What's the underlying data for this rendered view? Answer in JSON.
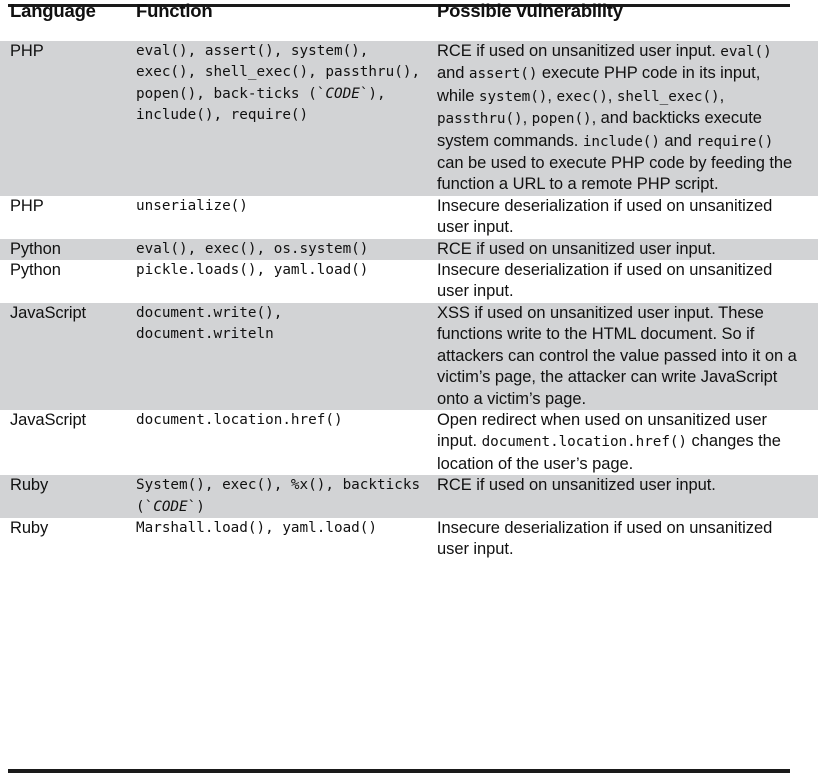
{
  "table": {
    "columns": [
      {
        "key": "language",
        "label": "Language"
      },
      {
        "key": "function",
        "label": "Function"
      },
      {
        "key": "vulnerability",
        "label": "Possible vulnerability"
      }
    ],
    "colors": {
      "shaded_row": "#d2d3d5",
      "plain_row": "#ffffff",
      "rule": "#1a1a1a",
      "text": "#111111"
    },
    "rows": [
      {
        "shaded": true,
        "language": "PHP",
        "function_plain": "eval(), assert(), system(), exec(), shell_exec(), passthru(), popen(), backticks (`CODE`), include(), require()",
        "function_parts": [
          {
            "type": "code",
            "text": "eval(), assert(), system(), exec(), shell_exec(), passthru(), popen(), back-ticks (`"
          },
          {
            "type": "code-italic",
            "text": "CODE"
          },
          {
            "type": "code",
            "text": "`), include(), require()"
          }
        ],
        "vulnerability_plain": "RCE if used on unsanitized user input. eval() and assert() execute PHP code in its input, while system(), exec(), shell_exec(), passthru(), popen(), and backticks execute system commands. include() and require() can be used to execute PHP code by feeding the function a URL to a remote PHP script.",
        "vulnerability_parts": [
          {
            "type": "text",
            "text": "RCE if used on unsanitized user input. "
          },
          {
            "type": "code",
            "text": "eval()"
          },
          {
            "type": "text",
            "text": " and "
          },
          {
            "type": "code",
            "text": "assert()"
          },
          {
            "type": "text",
            "text": " execute PHP code in its input, while "
          },
          {
            "type": "code",
            "text": "system()"
          },
          {
            "type": "text",
            "text": ", "
          },
          {
            "type": "code",
            "text": "exec()"
          },
          {
            "type": "text",
            "text": ", "
          },
          {
            "type": "code",
            "text": "shell_exec()"
          },
          {
            "type": "text",
            "text": ", "
          },
          {
            "type": "code",
            "text": "passthru()"
          },
          {
            "type": "text",
            "text": ", "
          },
          {
            "type": "code",
            "text": "popen()"
          },
          {
            "type": "text",
            "text": ", and backticks execute system commands. "
          },
          {
            "type": "code",
            "text": "include()"
          },
          {
            "type": "text",
            "text": " and "
          },
          {
            "type": "code",
            "text": "require()"
          },
          {
            "type": "text",
            "text": " can be used to execute PHP code by feeding the function a URL to a remote PHP script."
          }
        ]
      },
      {
        "shaded": false,
        "language": "PHP",
        "function_plain": "unserialize()",
        "function_parts": [
          {
            "type": "code",
            "text": "unserialize()"
          }
        ],
        "vulnerability_plain": "Insecure deserialization if used on unsanitized user input.",
        "vulnerability_parts": [
          {
            "type": "text",
            "text": "Insecure deserialization if used on unsanitized user input."
          }
        ]
      },
      {
        "shaded": true,
        "language": "Python",
        "function_plain": "eval(), exec(), os.system()",
        "function_parts": [
          {
            "type": "code",
            "text": "eval(), exec(), os.system()"
          }
        ],
        "vulnerability_plain": "RCE if used on unsanitized user input.",
        "vulnerability_parts": [
          {
            "type": "text",
            "text": "RCE if used on unsanitized user input."
          }
        ]
      },
      {
        "shaded": false,
        "language": "Python",
        "function_plain": "pickle.loads(), yaml.load()",
        "function_parts": [
          {
            "type": "code",
            "text": "pickle.loads(), yaml.load()"
          }
        ],
        "vulnerability_plain": "Insecure deserialization if used on unsanitized user input.",
        "vulnerability_parts": [
          {
            "type": "text",
            "text": "Insecure deserialization if used on unsanitized user input."
          }
        ]
      },
      {
        "shaded": true,
        "language": "JavaScript",
        "function_plain": "document.write(), document.writeln",
        "function_parts": [
          {
            "type": "code",
            "text": "document.write(), document.writeln"
          }
        ],
        "vulnerability_plain": "XSS if used on unsanitized user input. These functions write to the HTML document. So if attackers can control the value passed into it on a victim's page, the attacker can write JavaScript onto a victim's page.",
        "vulnerability_parts": [
          {
            "type": "text",
            "text": "XSS if used on unsanitized user input. These functions write to the HTML document. So if attackers can control the value passed into it on a victim’s page, the attacker can write JavaScript onto a victim’s page."
          }
        ]
      },
      {
        "shaded": false,
        "language": "JavaScript",
        "function_plain": "document.location.href()",
        "function_parts": [
          {
            "type": "code",
            "text": "document.location.href()"
          }
        ],
        "vulnerability_plain": "Open redirect when used on unsanitized user input. document.location.href() changes the location of the user's page.",
        "vulnerability_parts": [
          {
            "type": "text",
            "text": "Open redirect when used on unsanitized user input. "
          },
          {
            "type": "code",
            "text": "document.location.href()"
          },
          {
            "type": "text",
            "text": " changes the location of the user’s page."
          }
        ]
      },
      {
        "shaded": true,
        "language": "Ruby",
        "function_plain": "System(), exec(), %x(), backticks (`CODE`)",
        "function_parts": [
          {
            "type": "code",
            "text": "System(), exec(), %x(), backticks (`"
          },
          {
            "type": "code-italic",
            "text": "CODE"
          },
          {
            "type": "code",
            "text": "`)"
          }
        ],
        "vulnerability_plain": "RCE if used on unsanitized user input.",
        "vulnerability_parts": [
          {
            "type": "text",
            "text": "RCE if used on unsanitized user input."
          }
        ]
      },
      {
        "shaded": false,
        "language": "Ruby",
        "function_plain": "Marshall.load(), yaml.load()",
        "function_parts": [
          {
            "type": "code",
            "text": "Marshall.load(), yaml.load()"
          }
        ],
        "vulnerability_plain": "Insecure deserialization if used on unsanitized user input.",
        "vulnerability_parts": [
          {
            "type": "text",
            "text": "Insecure deserialization if used on unsanitized user input."
          }
        ]
      }
    ]
  }
}
